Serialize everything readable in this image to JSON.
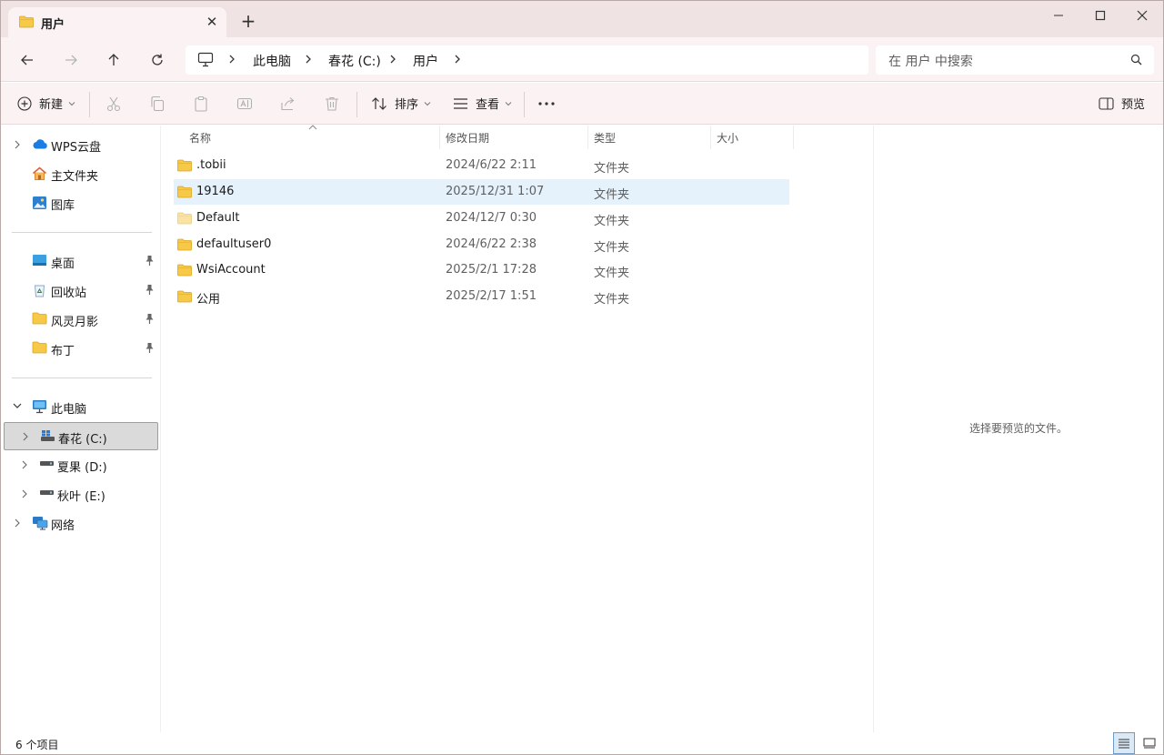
{
  "window": {
    "tab_title": "用户",
    "tab_close": "✕",
    "new_tab": "+"
  },
  "nav": {
    "breadcrumb": [
      "此电脑",
      "春花 (C:)",
      "用户"
    ],
    "search_placeholder": "在 用户 中搜索"
  },
  "toolbar": {
    "new_label": "新建",
    "sort_label": "排序",
    "view_label": "查看",
    "preview_label": "预览"
  },
  "sidebar": {
    "quick": [
      {
        "label": "WPS云盘",
        "icon": "cloud-icon",
        "expandable": true
      },
      {
        "label": "主文件夹",
        "icon": "home-icon",
        "expandable": false
      },
      {
        "label": "图库",
        "icon": "gallery-icon",
        "expandable": false
      }
    ],
    "pinned": [
      {
        "label": "桌面",
        "icon": "desktop-icon"
      },
      {
        "label": "回收站",
        "icon": "recycle-bin-icon"
      },
      {
        "label": "风灵月影",
        "icon": "folder-icon"
      },
      {
        "label": "布丁",
        "icon": "folder-icon"
      }
    ],
    "this_pc": "此电脑",
    "drives": [
      {
        "label": "春花 (C:)",
        "selected": true
      },
      {
        "label": "夏果 (D:)",
        "selected": false
      },
      {
        "label": "秋叶 (E:)",
        "selected": false
      }
    ],
    "network": "网络"
  },
  "columns": {
    "name": "名称",
    "modified": "修改日期",
    "type": "类型",
    "size": "大小"
  },
  "files": [
    {
      "name": ".tobii",
      "modified": "2024/6/22 2:11",
      "type": "文件夹",
      "selected": false,
      "faded": false
    },
    {
      "name": "19146",
      "modified": "2025/12/31 1:07",
      "type": "文件夹",
      "selected": true,
      "faded": false
    },
    {
      "name": "Default",
      "modified": "2024/12/7 0:30",
      "type": "文件夹",
      "selected": false,
      "faded": true
    },
    {
      "name": "defaultuser0",
      "modified": "2024/6/22 2:38",
      "type": "文件夹",
      "selected": false,
      "faded": false
    },
    {
      "name": "WsiAccount",
      "modified": "2025/2/1 17:28",
      "type": "文件夹",
      "selected": false,
      "faded": false
    },
    {
      "name": "公用",
      "modified": "2025/2/17 1:51",
      "type": "文件夹",
      "selected": false,
      "faded": false
    }
  ],
  "preview_message": "选择要预览的文件。",
  "status": {
    "item_count": "6 个项目"
  },
  "colors": {
    "title_bg": "#f0e3e3",
    "bar_bg": "#fbf3f3",
    "folder": "#f7c948",
    "selection": "#e5f1fb"
  }
}
